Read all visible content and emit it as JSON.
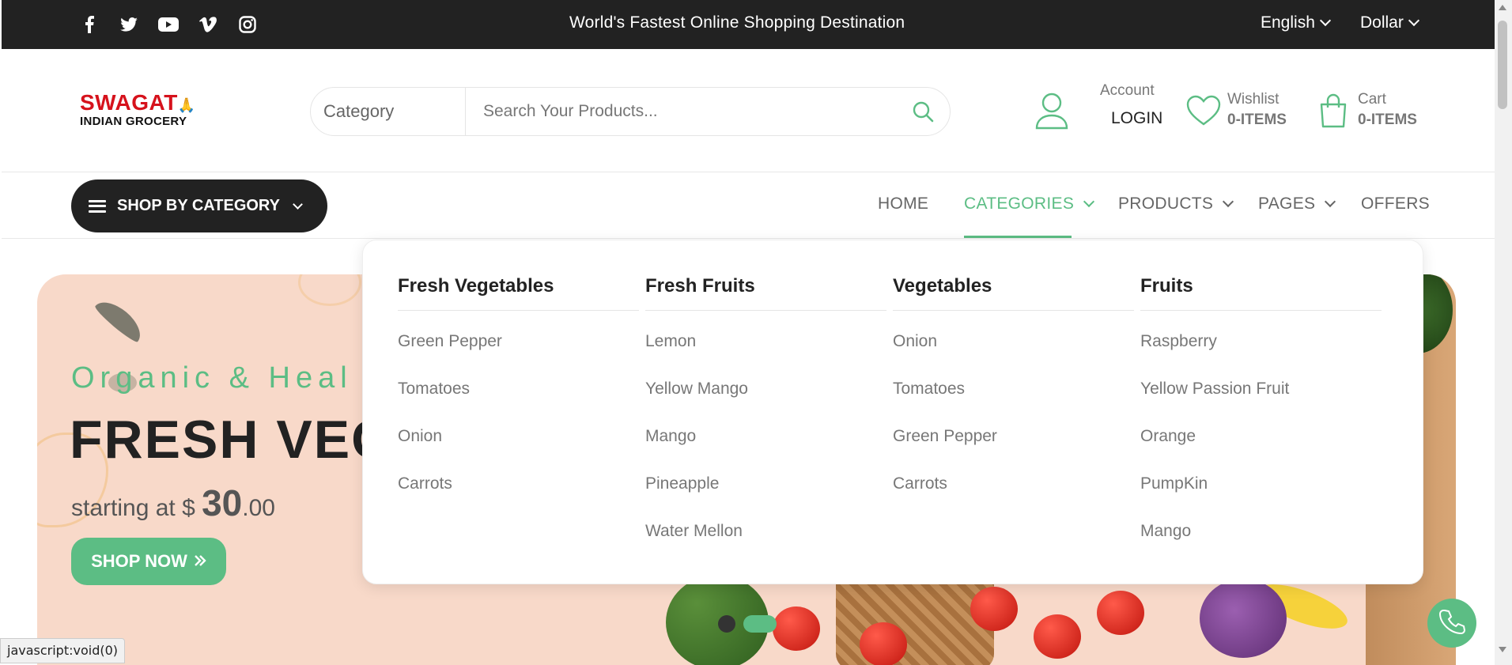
{
  "topbar": {
    "social_icons": [
      "facebook-icon",
      "twitter-icon",
      "youtube-icon",
      "vimeo-icon",
      "instagram-icon"
    ],
    "tagline": "World's Fastest Online Shopping Destination",
    "language": "English",
    "currency": "Dollar"
  },
  "header": {
    "logo_line1": "SWAGAT",
    "logo_line2": "INDIAN GROCERY",
    "search": {
      "category_label": "Category",
      "placeholder": "Search Your Products..."
    },
    "account": {
      "label": "Account",
      "action": "LOGIN"
    },
    "wishlist": {
      "label": "Wishlist",
      "value": "0-ITEMS"
    },
    "cart": {
      "label": "Cart",
      "value": "0-ITEMS"
    }
  },
  "nav": {
    "shop_by_category": "SHOP BY CATEGORY",
    "items": [
      {
        "label": "HOME"
      },
      {
        "label": "CATEGORIES",
        "active": true
      },
      {
        "label": "PRODUCTS"
      },
      {
        "label": "PAGES"
      },
      {
        "label": "OFFERS"
      }
    ]
  },
  "banner": {
    "tagline": "Organic & Heal",
    "title": "FRESH VEG",
    "price_prefix": "starting at $ ",
    "price_whole": "30",
    "price_cents": ".00",
    "cta": "SHOP NOW"
  },
  "dropdown": {
    "columns": [
      {
        "title": "Fresh Vegetables",
        "items": [
          "Green Pepper",
          "Tomatoes",
          "Onion",
          "Carrots"
        ]
      },
      {
        "title": "Fresh Fruits",
        "items": [
          "Lemon",
          "Yellow Mango",
          "Mango",
          "Pineapple",
          "Water Mellon"
        ]
      },
      {
        "title": "Vegetables",
        "items": [
          "Onion",
          "Tomatoes",
          "Green Pepper",
          "Carrots"
        ]
      },
      {
        "title": "Fruits",
        "items": [
          "Raspberry",
          "Yellow Passion Fruit",
          "Orange",
          "PumpKin",
          "Mango"
        ]
      }
    ]
  },
  "status_bar": "javascript:void(0)",
  "colors": {
    "accent": "#5cbd84",
    "dark": "#222222",
    "brand_red": "#d6121c",
    "banner_bg": "#f8d9c9"
  }
}
